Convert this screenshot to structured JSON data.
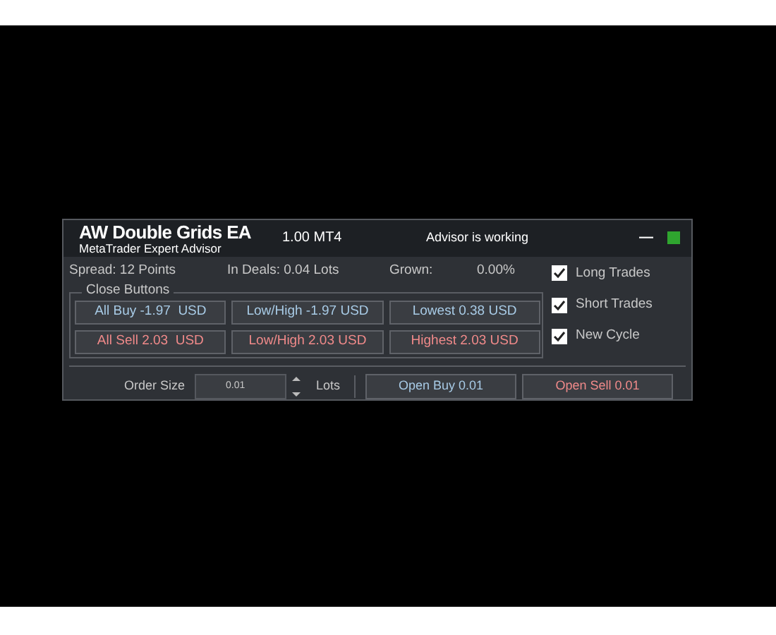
{
  "header": {
    "title": "AW Double Grids EA",
    "subtitle": "MetaTrader Expert Advisor",
    "version": "1.00 MT4",
    "status": "Advisor is working",
    "minimize": "—",
    "running": true
  },
  "stats": [
    {
      "label": "Spread: 12 Points"
    },
    {
      "label": "In Deals: 0.04 Lots"
    },
    {
      "label": "Grown:"
    },
    {
      "label": "0.00%"
    }
  ],
  "close_group": {
    "title": "Close Buttons",
    "buttons": [
      {
        "label": "All Buy -1.97  USD",
        "kind": "buy"
      },
      {
        "label": "Low/High -1.97 USD",
        "kind": "buy"
      },
      {
        "label": "Lowest 0.38 USD",
        "kind": "buy"
      },
      {
        "label": "All Sell 2.03  USD",
        "kind": "sell"
      },
      {
        "label": "Low/High 2.03 USD",
        "kind": "sell"
      },
      {
        "label": "Highest 2.03 USD",
        "kind": "sell"
      }
    ]
  },
  "options": [
    {
      "label": "Long Trades",
      "checked": true
    },
    {
      "label": "Short Trades",
      "checked": true
    },
    {
      "label": "New Cycle",
      "checked": true
    }
  ],
  "order": {
    "label": "Order Size",
    "value": "0.01",
    "unit": "Lots"
  },
  "actions": [
    {
      "label": "Open Buy 0.01",
      "kind": "buy"
    },
    {
      "label": "Open Sell 0.01",
      "kind": "sell"
    }
  ]
}
